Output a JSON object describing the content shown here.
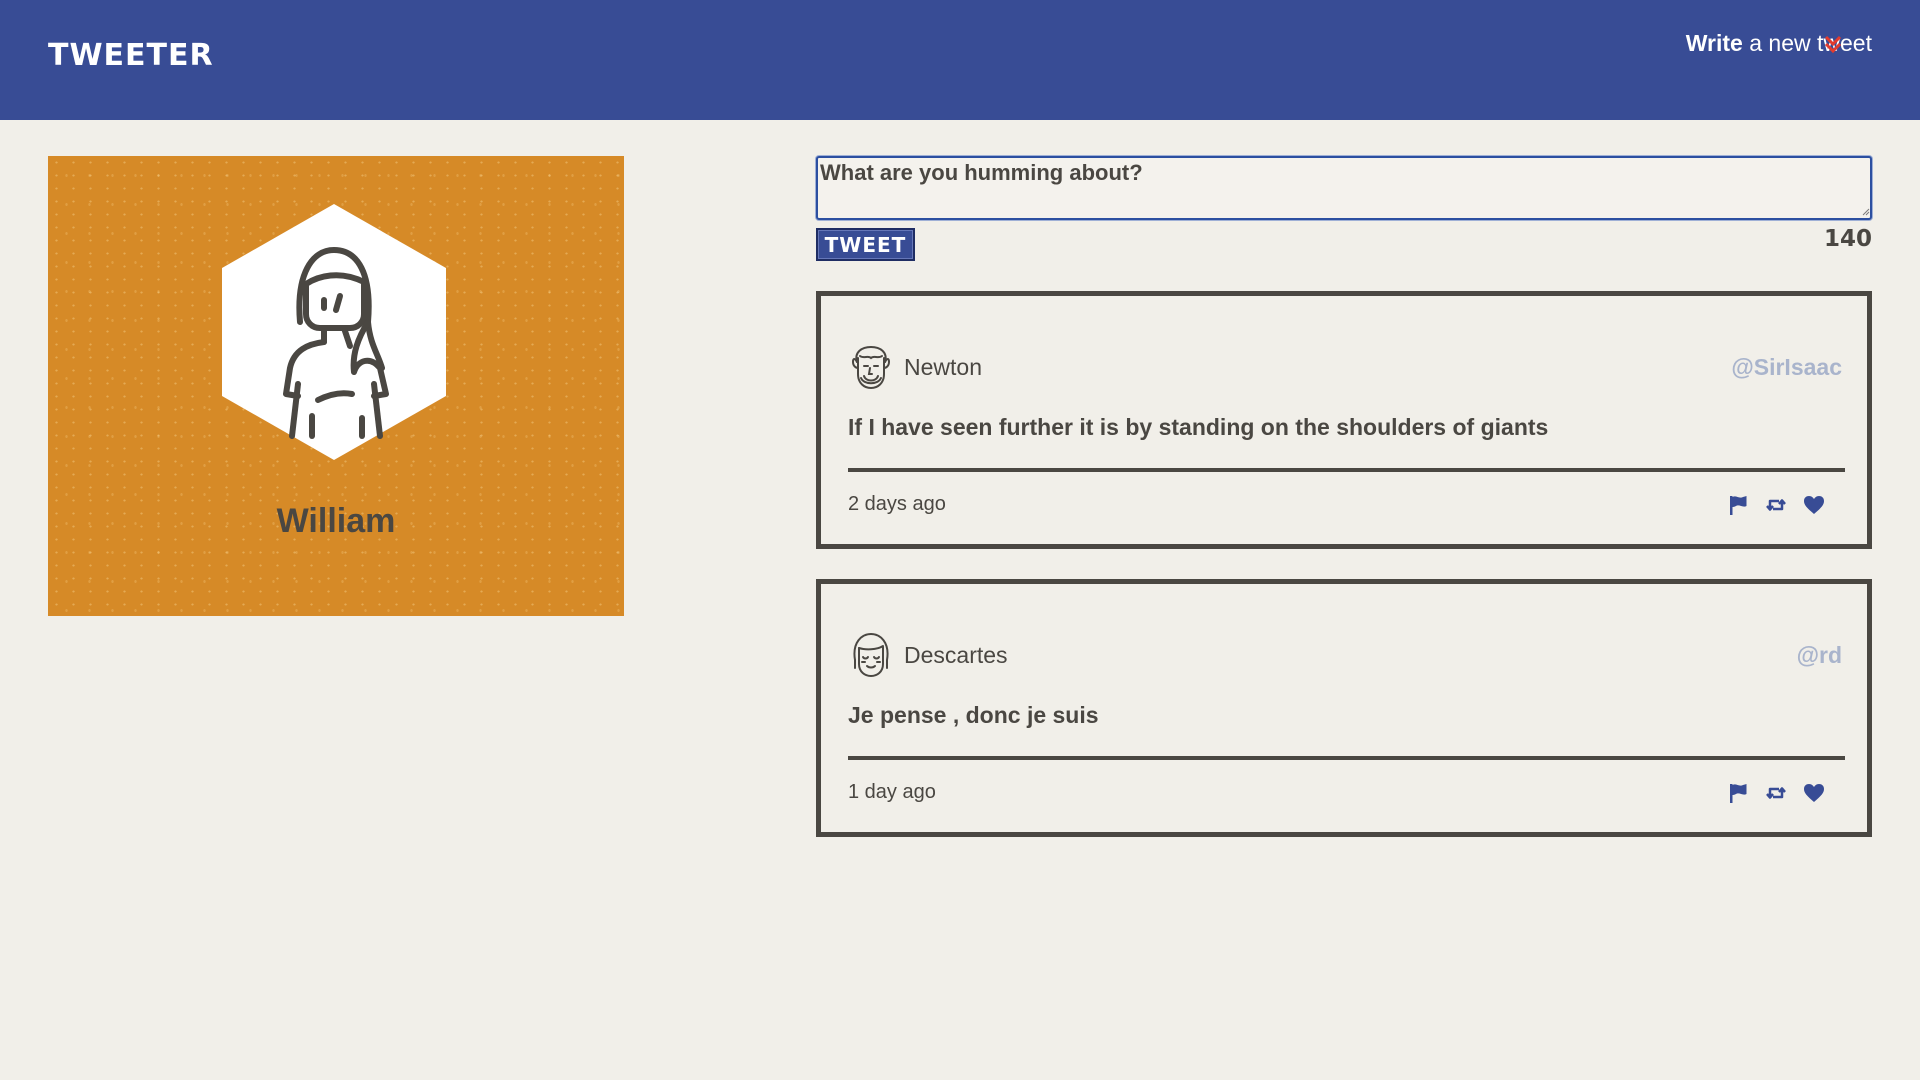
{
  "navbar": {
    "brand": "TWEETER",
    "compose_strong": "Write",
    "compose_rest": " a new tweet"
  },
  "profile": {
    "name": "William",
    "accent_color": "#d68a27"
  },
  "compose": {
    "placeholder": "What are you humming about?",
    "button_label": "TWEET",
    "counter": "140"
  },
  "tweets": [
    {
      "author": "Newton",
      "handle": "@SirIsaac",
      "content": "If I have seen further it is by standing on the shoulders of giants",
      "time": "2 days ago"
    },
    {
      "author": "Descartes",
      "handle": "@rd",
      "content": "Je pense , donc je suis",
      "time": "1 day ago"
    }
  ],
  "colors": {
    "navbar": "#384c95",
    "background": "#f1efe9",
    "text": "#4a4742",
    "handle": "#a9b4cc",
    "compose_arrow": "#e23b2e"
  },
  "icons": {
    "flag": "flag-icon",
    "retweet": "retweet-icon",
    "like": "heart-icon",
    "compose_arrow": "chevron-double-down-icon"
  }
}
